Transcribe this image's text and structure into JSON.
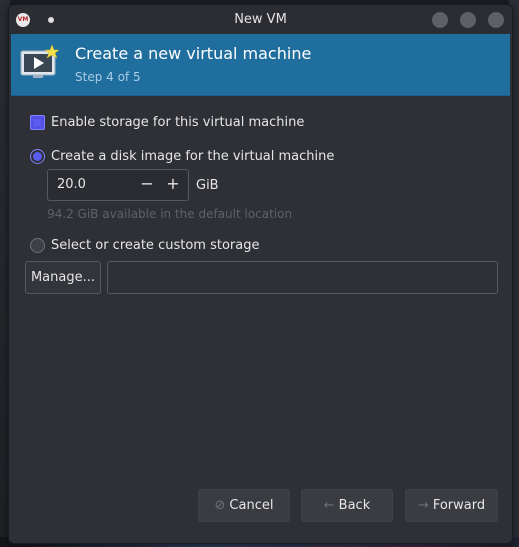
{
  "window": {
    "title": "New VM",
    "app_icon_text": "VM"
  },
  "header": {
    "title": "Create a new virtual machine",
    "step": "Step 4 of 5"
  },
  "storage": {
    "enable_label": "Enable storage for this virtual machine",
    "enable_checked": true,
    "create_disk_label": "Create a disk image for the virtual machine",
    "create_disk_selected": true,
    "size_value": "20.0",
    "minus_label": "−",
    "plus_label": "+",
    "unit": "GiB",
    "available_text": "94.2 GiB available in the default location",
    "custom_label": "Select or create custom storage",
    "custom_selected": false,
    "manage_label": "Manage...",
    "path_value": ""
  },
  "footer": {
    "cancel_label": "Cancel",
    "back_label": "Back",
    "forward_label": "Forward"
  },
  "colors": {
    "header_bg": "#1f6e9e",
    "accent": "#5b5cf0",
    "window_bg": "#2e3035"
  },
  "icons": {
    "app": "vm-app-icon",
    "header": "monitor-play-icon",
    "cancel": "cancel-circle-icon",
    "back": "arrow-left-icon",
    "forward": "arrow-right-icon"
  }
}
